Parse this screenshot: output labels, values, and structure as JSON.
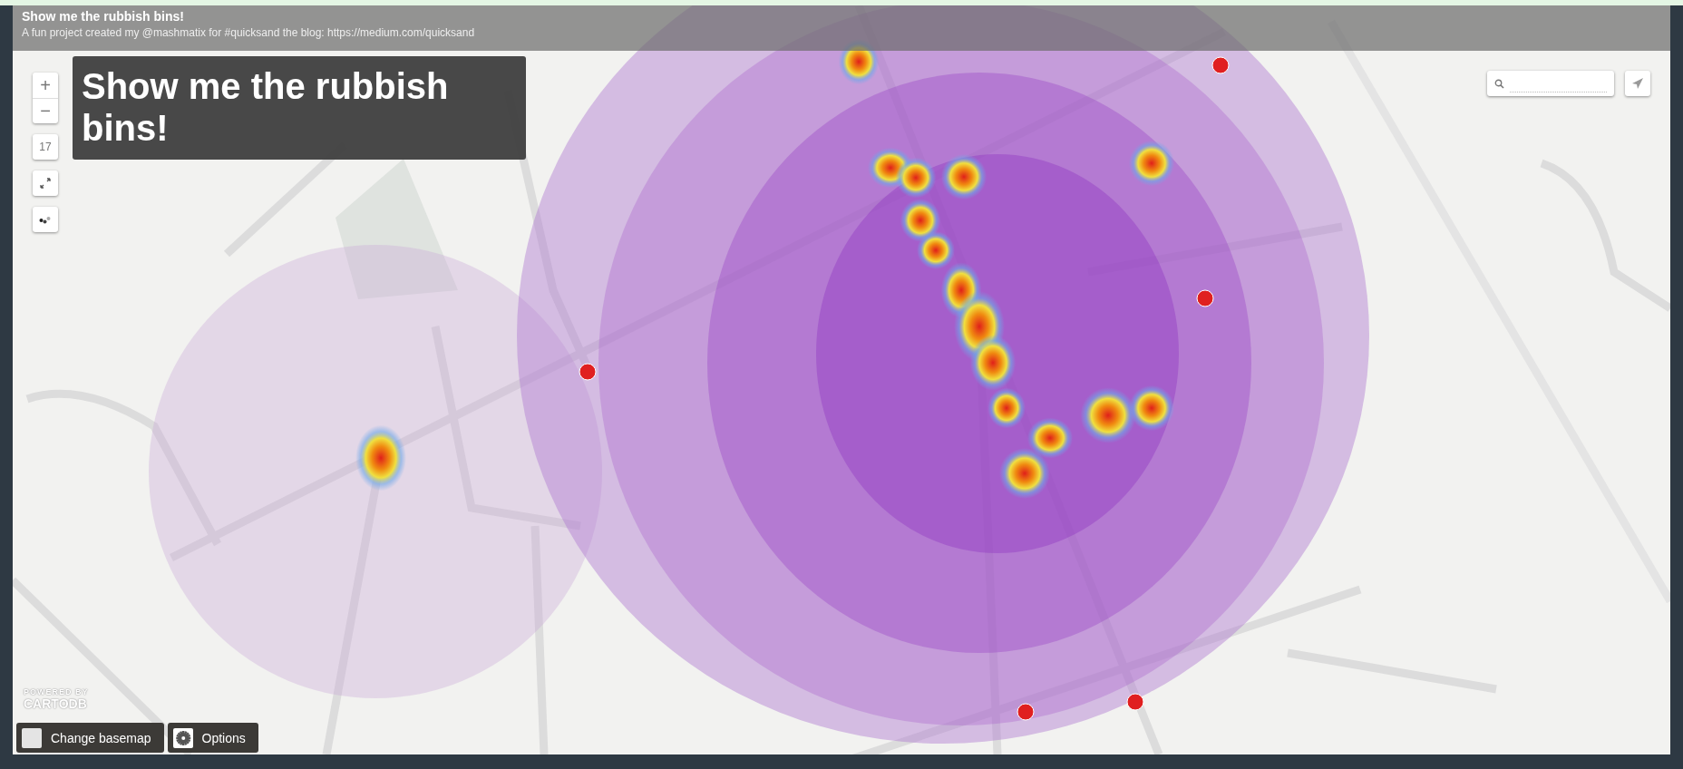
{
  "header": {
    "title": "Show me the rubbish bins!",
    "subtitle": "A fun project created my @mashmatix for #quicksand the blog: https://medium.com/quicksand"
  },
  "title_box": {
    "text": "Show me the rubbish bins!"
  },
  "zoom_controls": {
    "zoom_in": "+",
    "zoom_out": "−",
    "level": "17"
  },
  "attribution": {
    "powered_by": "POWERED BY",
    "brand": "CARTODB"
  },
  "buttons": [
    {
      "kind": "basemap",
      "label": "Change basemap"
    },
    {
      "kind": "options",
      "label": "Options"
    }
  ]
}
